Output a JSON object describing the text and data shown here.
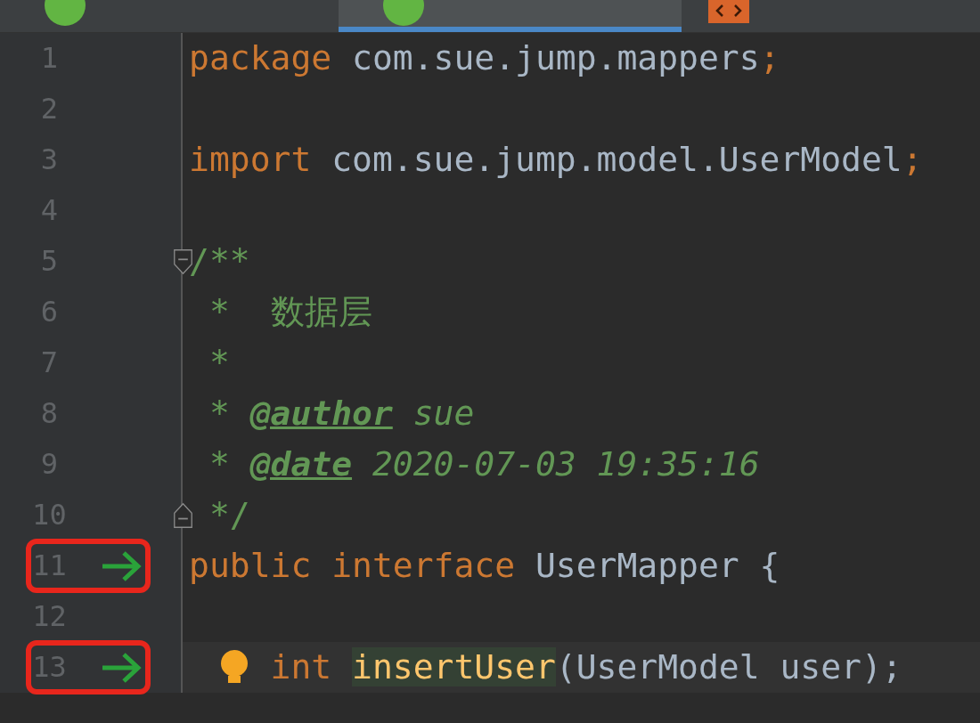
{
  "tabs": [
    {
      "kind": "java",
      "selected": false
    },
    {
      "kind": "java",
      "selected": true
    },
    {
      "kind": "xml",
      "selected": false
    }
  ],
  "lines": [
    {
      "number": "1",
      "tokens": [
        {
          "text": "package",
          "kind": "keyword"
        },
        {
          "text": " com.sue.jump.mappers",
          "kind": "plain"
        },
        {
          "text": ";",
          "kind": "keyword"
        }
      ]
    },
    {
      "number": "2"
    },
    {
      "number": "3",
      "tokens": [
        {
          "text": "import",
          "kind": "keyword"
        },
        {
          "text": " com.sue.jump.model.UserModel",
          "kind": "plain"
        },
        {
          "text": ";",
          "kind": "keyword"
        }
      ]
    },
    {
      "number": "4"
    },
    {
      "number": "5",
      "fold_start": true,
      "tokens": [
        {
          "text": "/**",
          "kind": "comment"
        }
      ]
    },
    {
      "number": "6",
      "tokens": [
        {
          "text": " *  数据层",
          "kind": "comment"
        }
      ]
    },
    {
      "number": "7",
      "tokens": [
        {
          "text": " *",
          "kind": "comment"
        }
      ]
    },
    {
      "number": "8",
      "tokens": [
        {
          "text": " * ",
          "kind": "comment"
        },
        {
          "text": "@author",
          "kind": "doctag"
        },
        {
          "text": " sue",
          "kind": "docvalue"
        }
      ]
    },
    {
      "number": "9",
      "tokens": [
        {
          "text": " * ",
          "kind": "comment"
        },
        {
          "text": "@date",
          "kind": "doctag"
        },
        {
          "text": " 2020-07-03 19:35:16",
          "kind": "docvalue"
        }
      ]
    },
    {
      "number": "10",
      "fold_end": true,
      "tokens": [
        {
          "text": " */",
          "kind": "comment"
        }
      ]
    },
    {
      "number": "11",
      "implemented": true,
      "highlighted": true,
      "tokens": [
        {
          "text": "public interface",
          "kind": "keyword"
        },
        {
          "text": " UserMapper {",
          "kind": "plain"
        }
      ]
    },
    {
      "number": "12"
    },
    {
      "number": "13",
      "implemented": true,
      "highlighted": true,
      "current": true,
      "bulb": true,
      "tokens": [
        {
          "text": "    int ",
          "kind": "keyword"
        },
        {
          "text": "insertUser",
          "kind": "method"
        },
        {
          "text": "(UserModel user);",
          "kind": "plain"
        }
      ]
    }
  ]
}
